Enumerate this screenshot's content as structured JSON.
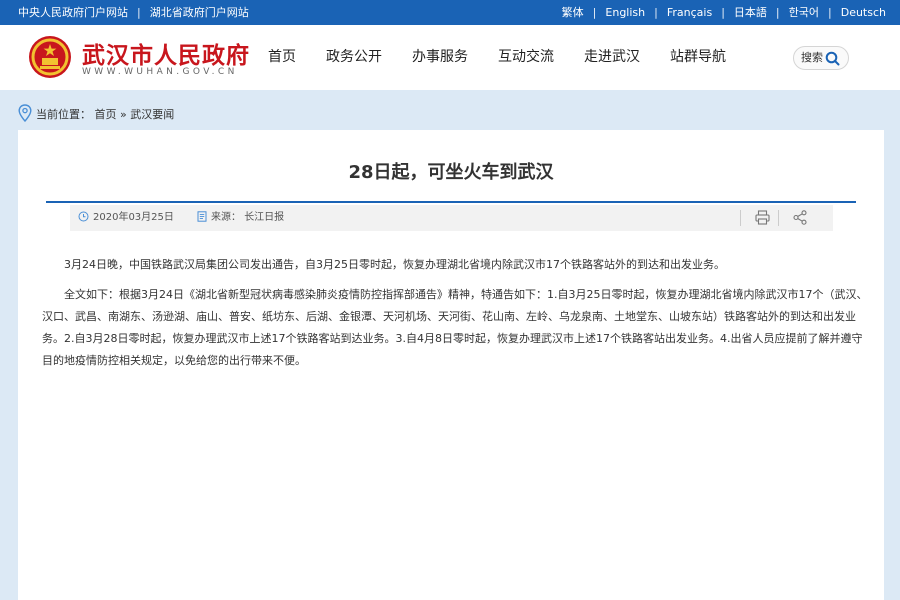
{
  "topbar": {
    "links_left": [
      "中央人民政府门户网站",
      "湖北省政府门户网站"
    ],
    "languages": [
      "繁体",
      "English",
      "Français",
      "日本語",
      "한국어",
      "Deutsch"
    ]
  },
  "header": {
    "site_title": "武汉市人民政府",
    "site_url": "WWW.WUHAN.GOV.CN",
    "nav": [
      "首页",
      "政务公开",
      "办事服务",
      "互动交流",
      "走进武汉",
      "站群导航"
    ],
    "search_label": "搜索"
  },
  "breadcrumb": {
    "label": "当前位置：",
    "home": "首页",
    "separator": "»",
    "current": "武汉要闻"
  },
  "article": {
    "title": "28日起，可坐火车到武汉",
    "date": "2020年03月25日",
    "source_label": "来源：",
    "source": "长江日报",
    "paragraphs": [
      "3月24日晚，中国铁路武汉局集团公司发出通告，自3月25日零时起，恢复办理湖北省境内除武汉市17个铁路客站外的到达和出发业务。",
      "全文如下：根据3月24日《湖北省新型冠状病毒感染肺炎疫情防控指挥部通告》精神，特通告如下：1.自3月25日零时起，恢复办理湖北省境内除武汉市17个（武汉、汉口、武昌、南湖东、汤逊湖、庙山、普安、纸坊东、后湖、金银潭、天河机场、天河街、花山南、左岭、乌龙泉南、土地堂东、山坡东站）铁路客站外的到达和出发业务。2.自3月28日零时起，恢复办理武汉市上述17个铁路客站到达业务。3.自4月8日零时起，恢复办理武汉市上述17个铁路客站出发业务。4.出省人员应提前了解并遵守目的地疫情防控相关规定，以免给您的出行带来不便。"
    ]
  },
  "colors": {
    "brand_blue": "#1a63b5",
    "title_red": "#c8161d",
    "page_bg": "#dce9f5"
  },
  "icons": [
    "national-emblem-icon",
    "search-icon",
    "location-pin-icon",
    "clock-icon",
    "document-icon",
    "print-icon",
    "share-icon"
  ]
}
